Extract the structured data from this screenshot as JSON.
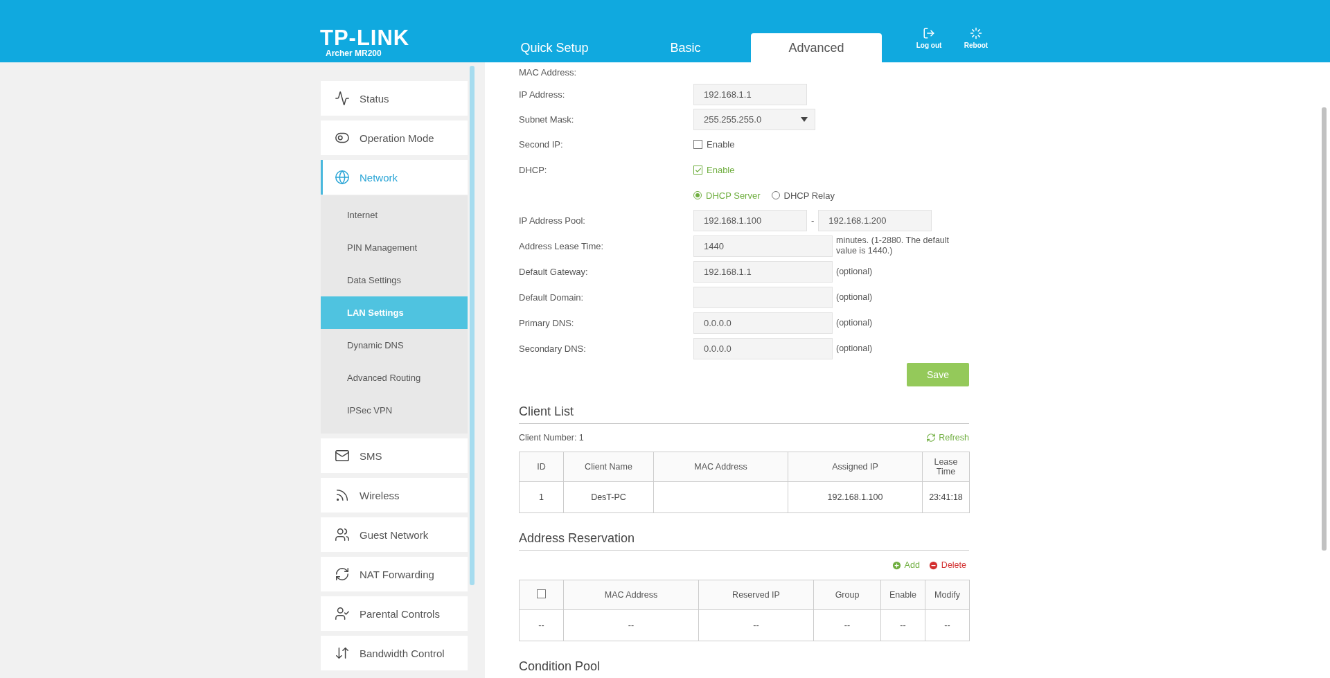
{
  "header": {
    "brand": "TP-LINK",
    "model": "Archer MR200",
    "tabs": [
      {
        "label": "Quick Setup",
        "selected": false
      },
      {
        "label": "Basic",
        "selected": false
      },
      {
        "label": "Advanced",
        "selected": true
      }
    ],
    "actions": [
      {
        "label": "Log out",
        "kind": "logout"
      },
      {
        "label": "Reboot",
        "kind": "reboot"
      }
    ]
  },
  "sidebar": {
    "items": [
      {
        "label": "Status",
        "selected": false
      },
      {
        "label": "Operation Mode",
        "selected": false
      },
      {
        "label": "Network",
        "selected": true,
        "expanded": true,
        "children": [
          {
            "label": "Internet",
            "selected": false
          },
          {
            "label": "PIN Management",
            "selected": false
          },
          {
            "label": "Data Settings",
            "selected": false
          },
          {
            "label": "LAN Settings",
            "selected": true
          },
          {
            "label": "Dynamic DNS",
            "selected": false
          },
          {
            "label": "Advanced Routing",
            "selected": false
          },
          {
            "label": "IPSec VPN",
            "selected": false
          }
        ]
      },
      {
        "label": "SMS",
        "selected": false
      },
      {
        "label": "Wireless",
        "selected": false
      },
      {
        "label": "Guest Network",
        "selected": false
      },
      {
        "label": "NAT Forwarding",
        "selected": false
      },
      {
        "label": "Parental Controls",
        "selected": false
      },
      {
        "label": "Bandwidth Control",
        "selected": false
      }
    ]
  },
  "form": {
    "rows": [
      {
        "kind": "static",
        "label": "MAC Address:"
      },
      {
        "kind": "text",
        "label": "IP Address:",
        "value": "192.168.1.1"
      },
      {
        "kind": "select",
        "label": "Subnet Mask:",
        "value": "255.255.255.0"
      },
      {
        "kind": "checkbox",
        "label": "Second IP:",
        "option": "Enable",
        "checked": false
      },
      {
        "kind": "checkbox",
        "label": "DHCP:",
        "option": "Enable",
        "checked": true
      },
      {
        "kind": "radio",
        "options": [
          {
            "label": "DHCP Server",
            "selected": true
          },
          {
            "label": "DHCP Relay",
            "selected": false
          }
        ]
      },
      {
        "kind": "range",
        "label": "IP Address Pool:",
        "from": "192.168.1.100",
        "separator": "-",
        "to": "192.168.1.200"
      },
      {
        "kind": "text",
        "label": "Address Lease Time:",
        "value": "1440",
        "note": "minutes. (1-2880. The default value is 1440.)"
      },
      {
        "kind": "text",
        "label": "Default Gateway:",
        "value": "192.168.1.1",
        "note": "(optional)"
      },
      {
        "kind": "text",
        "label": "Default Domain:",
        "note": "(optional)"
      },
      {
        "kind": "text",
        "label": "Primary DNS:",
        "value": "0.0.0.0",
        "note": "(optional)"
      },
      {
        "kind": "text",
        "label": "Secondary DNS:",
        "value": "0.0.0.0",
        "note": "(optional)"
      }
    ],
    "save": "Save"
  },
  "client_list": {
    "title": "Client List",
    "count": "Client Number: 1",
    "refresh": "Refresh",
    "columns": [
      "ID",
      "Client Name",
      "MAC Address",
      "Assigned IP",
      "Lease Time"
    ],
    "rows": [
      [
        "1",
        "DesT-PC",
        "",
        "192.168.1.100",
        "23:41:18"
      ]
    ]
  },
  "address_reservation": {
    "title": "Address Reservation",
    "add": "Add",
    "delete": "Delete",
    "select_all": {
      "checked": false
    },
    "columns": [
      "",
      "MAC Address",
      "Reserved IP",
      "Group",
      "Enable",
      "Modify"
    ],
    "rows": [
      [
        "--",
        "--",
        "--",
        "--",
        "--",
        "--"
      ]
    ]
  },
  "condition_pool": {
    "title": "Condition Pool"
  }
}
